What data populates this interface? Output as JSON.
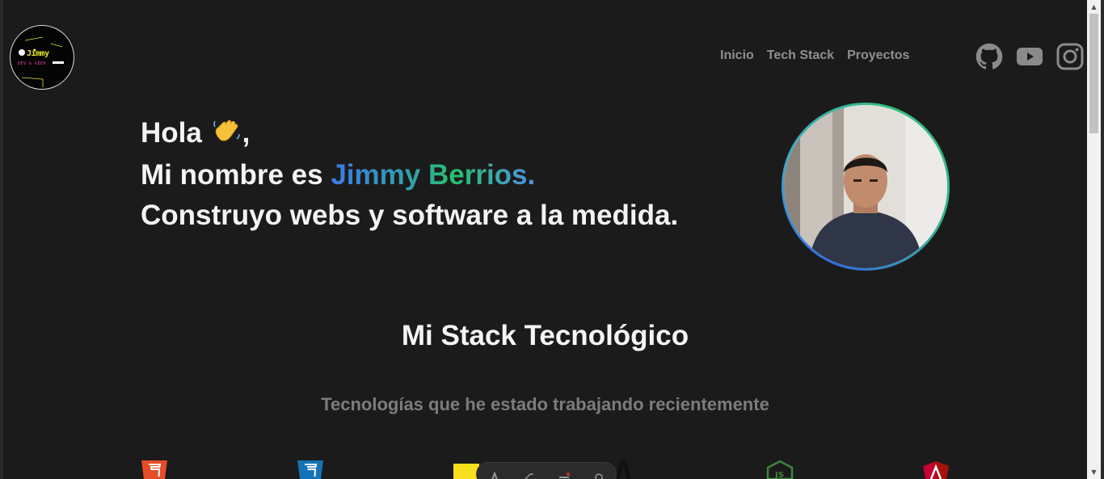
{
  "logo": {
    "text": "Jimmy",
    "subtext": "DEV & GEEK"
  },
  "nav": {
    "items": [
      "Inicio",
      "Tech Stack",
      "Proyectos"
    ]
  },
  "social": [
    "github-icon",
    "youtube-icon",
    "instagram-icon"
  ],
  "hero": {
    "greeting": "Hola",
    "greeting_suffix": ",",
    "intro_prefix": "Mi nombre es",
    "name": "Jimmy Berrios.",
    "tagline": "Construyo webs y software a la medida."
  },
  "stack": {
    "title": "Mi Stack Tecnológico",
    "subtitle": "Tecnologías que he estado trabajando recientemente",
    "icons": [
      "html5-icon",
      "css3-icon",
      "javascript-icon",
      "astro-icon",
      "nodejs-icon",
      "angular-icon"
    ]
  },
  "colors": {
    "background": "#1b1b1b",
    "nav_text": "#8f8f8f",
    "name_gradient_start": "#3b7ae8",
    "name_gradient_end": "#27c06a"
  }
}
